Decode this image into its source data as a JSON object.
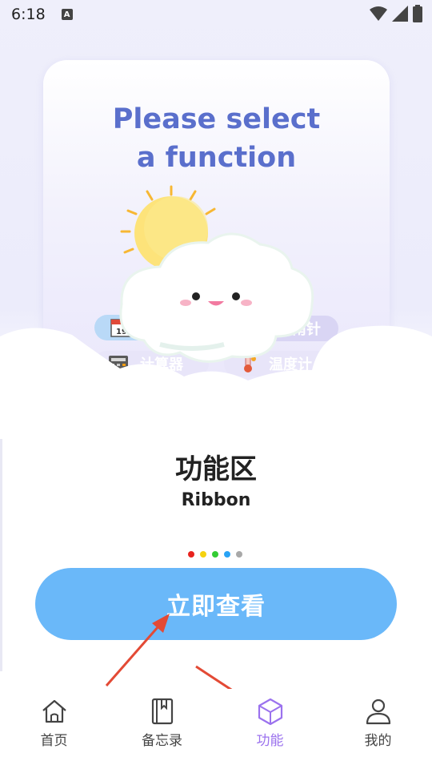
{
  "status_bar": {
    "time": "6:18",
    "notification_icon": "a-box-icon",
    "icons": [
      "wifi-icon",
      "signal-icon",
      "battery-icon"
    ]
  },
  "card": {
    "title": "Please select\na function",
    "chips": {
      "calendar": "",
      "compass": "指南针",
      "calculator": "计算器",
      "thermometer": "温度计"
    },
    "calendar_date": "19"
  },
  "main": {
    "title": "功能区",
    "subtitle": "Ribbon",
    "dots": [
      "#e8231e",
      "#f5d20f",
      "#33cc33",
      "#29a3f5",
      "#a8a8a8"
    ]
  },
  "cta": {
    "label": "立即查看"
  },
  "bottom_nav": {
    "items": [
      {
        "label": "首页",
        "icon": "home-icon"
      },
      {
        "label": "备忘录",
        "icon": "book-icon"
      },
      {
        "label": "功能",
        "icon": "cube-icon",
        "active": true
      },
      {
        "label": "我的",
        "icon": "person-icon"
      }
    ]
  },
  "colors": {
    "accent": "#9b72ee",
    "cta": "#6ab8f9",
    "title": "#5a6fcc",
    "arrow": "#e34a35"
  }
}
